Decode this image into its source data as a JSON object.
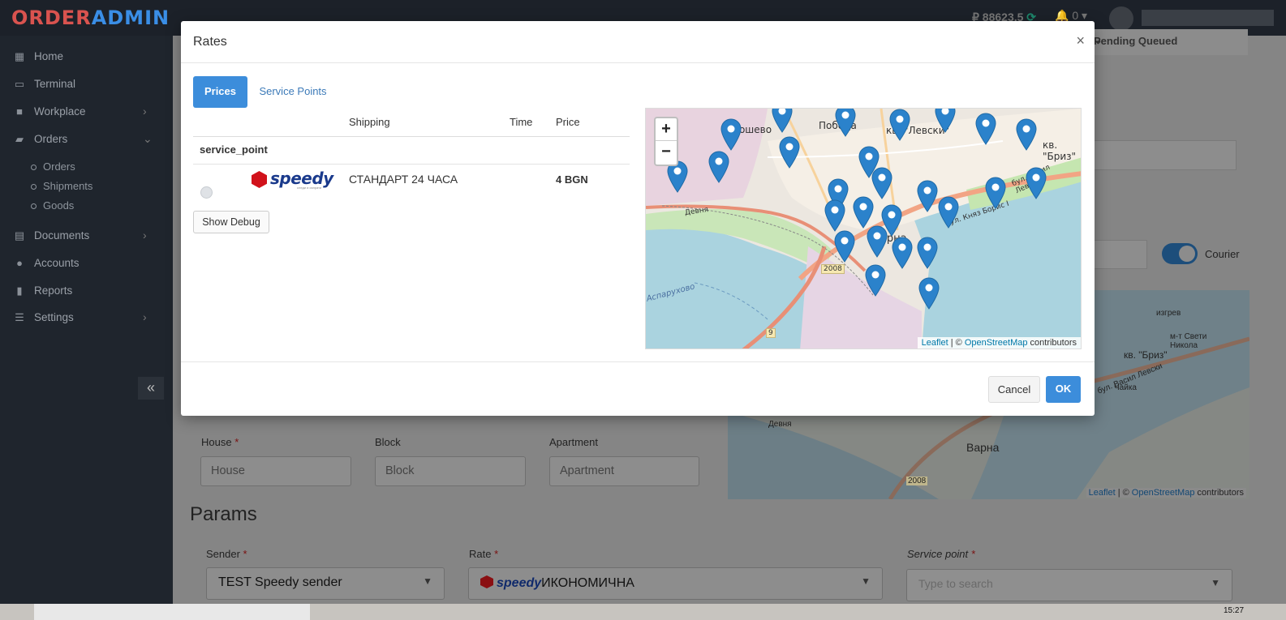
{
  "app": {
    "logo_part1": "ORDER",
    "logo_part2": "ADMIN"
  },
  "header": {
    "balance": "₽ 88623.5",
    "notifications": "0"
  },
  "sidebar": {
    "items": [
      {
        "label": "Home",
        "icon": "dashboard-icon"
      },
      {
        "label": "Terminal",
        "icon": "terminal-icon"
      },
      {
        "label": "Workplace",
        "icon": "briefcase-icon"
      },
      {
        "label": "Orders",
        "icon": "truck-icon"
      },
      {
        "label": "Documents",
        "icon": "document-icon"
      },
      {
        "label": "Accounts",
        "icon": "user-icon"
      },
      {
        "label": "Reports",
        "icon": "report-icon"
      },
      {
        "label": "Settings",
        "icon": "sliders-icon"
      }
    ],
    "sub_items": [
      "Orders",
      "Shipments",
      "Goods"
    ]
  },
  "background": {
    "status_select": "Pending Queued",
    "courier_label": "Courier",
    "house_label": "House",
    "house_placeholder": "House",
    "block_label": "Block",
    "block_placeholder": "Block",
    "apartment_label": "Apartment",
    "apartment_placeholder": "Apartment",
    "params_title": "Params",
    "sender_label": "Sender",
    "sender_value": "TEST Speedy sender",
    "rate_label": "Rate",
    "rate_value_logo": "speedy",
    "rate_value": "ИКОНОМИЧНА",
    "service_point_label": "Service point",
    "service_point_placeholder": "Type to search",
    "map_labels": [
      "Варна",
      "кв. \"Бриз\"",
      "изгрев",
      "м-т Свети Никола",
      "бул. Васил Левски",
      "Чайка",
      "2008",
      "Девня"
    ],
    "map_attrib_leaflet": "Leaflet",
    "map_attrib_osm": "OpenStreetMap",
    "map_attrib_suffix": "contributors"
  },
  "taskbar": {
    "clock": "15:27"
  },
  "modal": {
    "title": "Rates",
    "close": "×",
    "tabs": [
      {
        "label": "Prices",
        "active": true
      },
      {
        "label": "Service Points",
        "active": false
      }
    ],
    "table": {
      "headers": [
        "Shipping",
        "Time",
        "Price"
      ],
      "group": "service_point",
      "rows": [
        {
          "carrier": "speedy",
          "carrier_tagline": "следи и изпрати",
          "name": "СТАНДАРТ 24 ЧАСА",
          "time": "",
          "price": "4 BGN"
        }
      ]
    },
    "debug_button": "Show Debug",
    "map": {
      "zoom_in": "+",
      "zoom_out": "−",
      "labels": [
        "Трошево",
        "Победа",
        "кв. \"Левски\"",
        "кв. \"Бриз\"",
        "бул. Васил Левски",
        "Варна",
        "2008",
        "9",
        "Девня",
        "бул. Княз Борис I",
        "Аспарухово"
      ],
      "attrib_leaflet": "Leaflet",
      "attrib_sep": " | © ",
      "attrib_osm": "OpenStreetMap",
      "attrib_suffix": " contributors"
    },
    "cancel": "Cancel",
    "ok": "OK"
  },
  "colors": {
    "primary": "#3c8ddb",
    "sidebar": "#1f252d",
    "marker": "#2b82cb",
    "speedy_red": "#d1121b"
  }
}
